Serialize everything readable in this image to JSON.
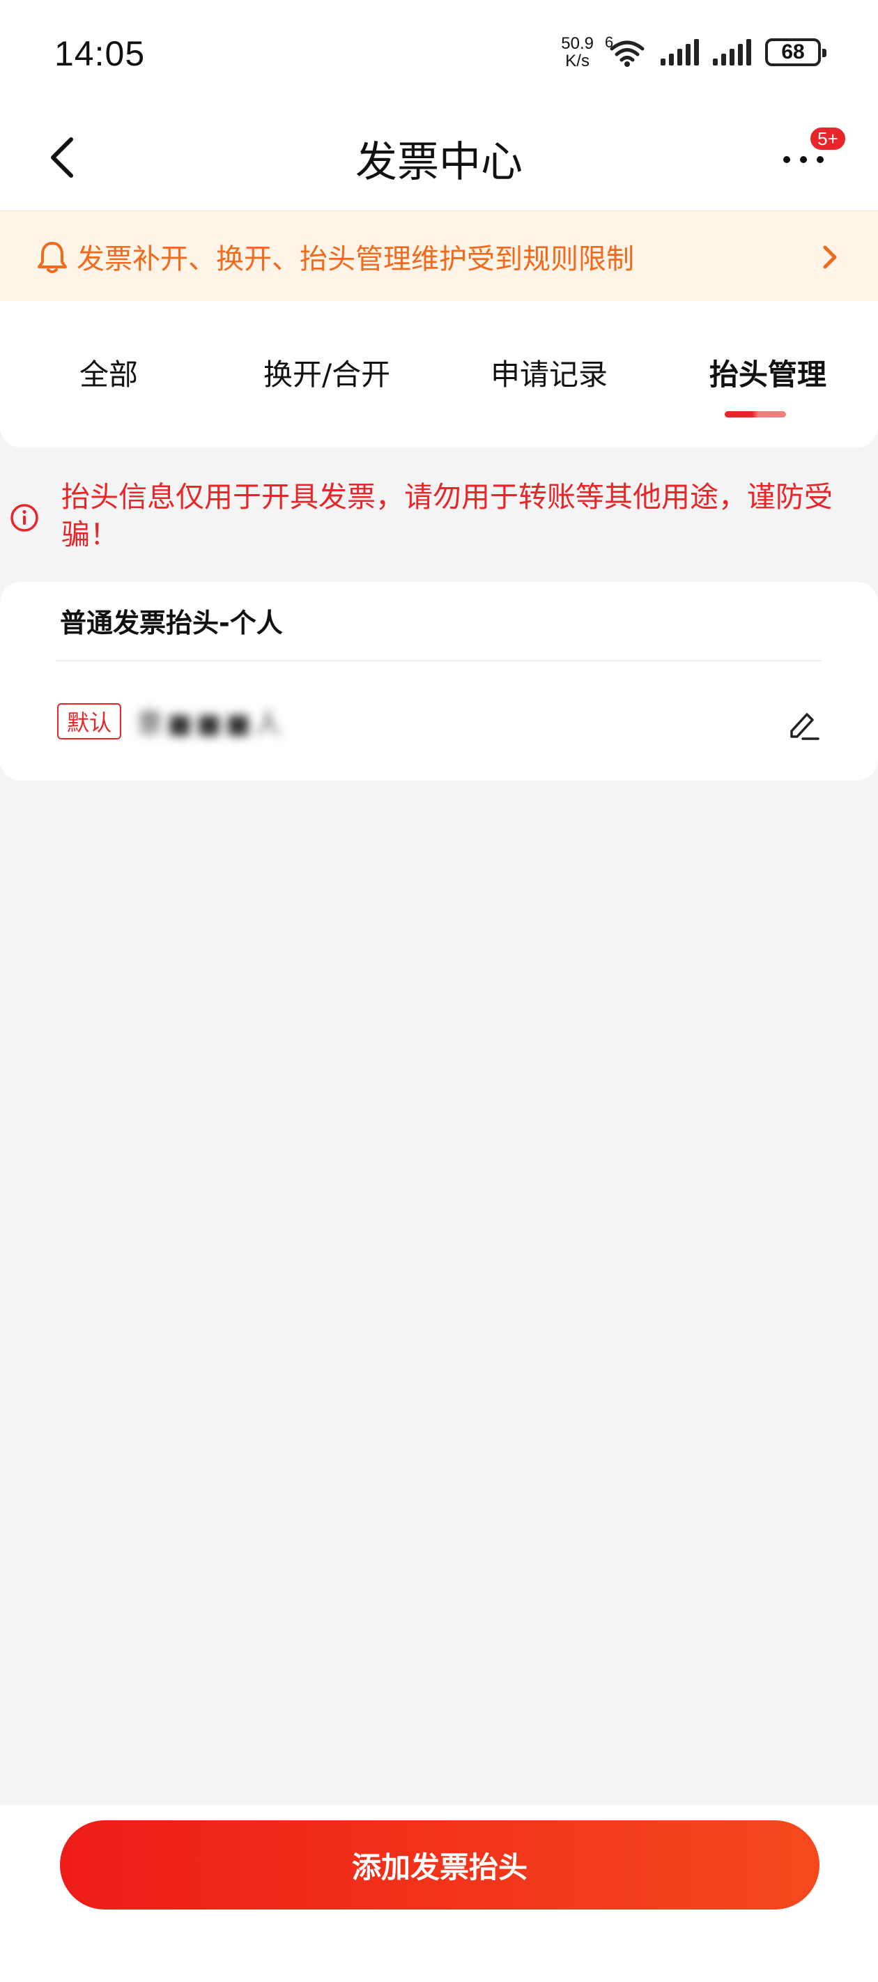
{
  "status_bar": {
    "time": "14:05",
    "net_speed_value": "50.9",
    "net_speed_unit": "K/s",
    "wifi_generation": "6",
    "battery_level": "68"
  },
  "header": {
    "title": "发票中心",
    "more_badge": "5+"
  },
  "notice": {
    "text": "发票补开、换开、抬头管理维护受到规则限制"
  },
  "tabs": [
    {
      "label": "全部"
    },
    {
      "label": "换开/合开"
    },
    {
      "label": "申请记录"
    },
    {
      "label": "抬头管理"
    }
  ],
  "active_tab": "抬头管理",
  "warning": {
    "text": "抬头信息仅用于开具发票，请勿用于转账等其他用途，谨防受骗！"
  },
  "invoice_title_card": {
    "heading": "普通发票抬头-个人",
    "default_tag": "默认",
    "name": "意■■■人"
  },
  "add_button_label": "添加发票抬头",
  "colors": {
    "accent": "#e8262a",
    "notice_text": "#f26a1b",
    "notice_bg": "#fff4e8",
    "page_bg": "#f4f4f4"
  }
}
